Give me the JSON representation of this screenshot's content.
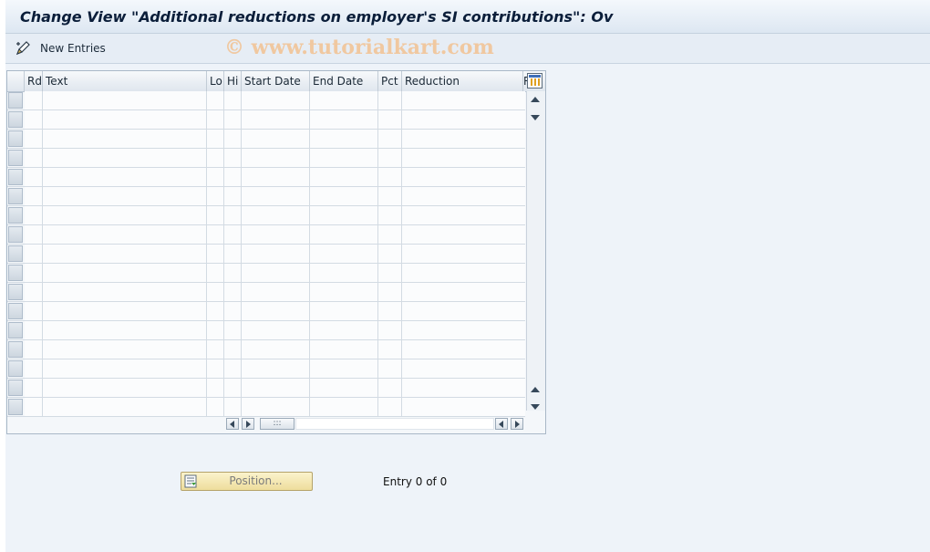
{
  "window": {
    "title": "Change View \"Additional reductions on employer's SI contributions\": Ov"
  },
  "watermark": "© www.tutorialkart.com",
  "toolbar": {
    "new_entries_label": "New Entries"
  },
  "table": {
    "columns": [
      "Rd",
      "Text",
      "Lo",
      "Hi",
      "Start Date",
      "End Date",
      "Pct",
      "Reduction",
      "R"
    ],
    "row_count": 17
  },
  "footer": {
    "position_label": "Position...",
    "entry_text": "Entry 0 of 0"
  },
  "icons": {
    "new_entries": "pencil-new-icon",
    "column_settings": "table-settings-icon",
    "position": "position-icon"
  },
  "colors": {
    "background": "#eef3f9",
    "title_text": "#0b1e3a",
    "position_button": "#f4e8b4",
    "watermark": "#f0c8a0"
  }
}
